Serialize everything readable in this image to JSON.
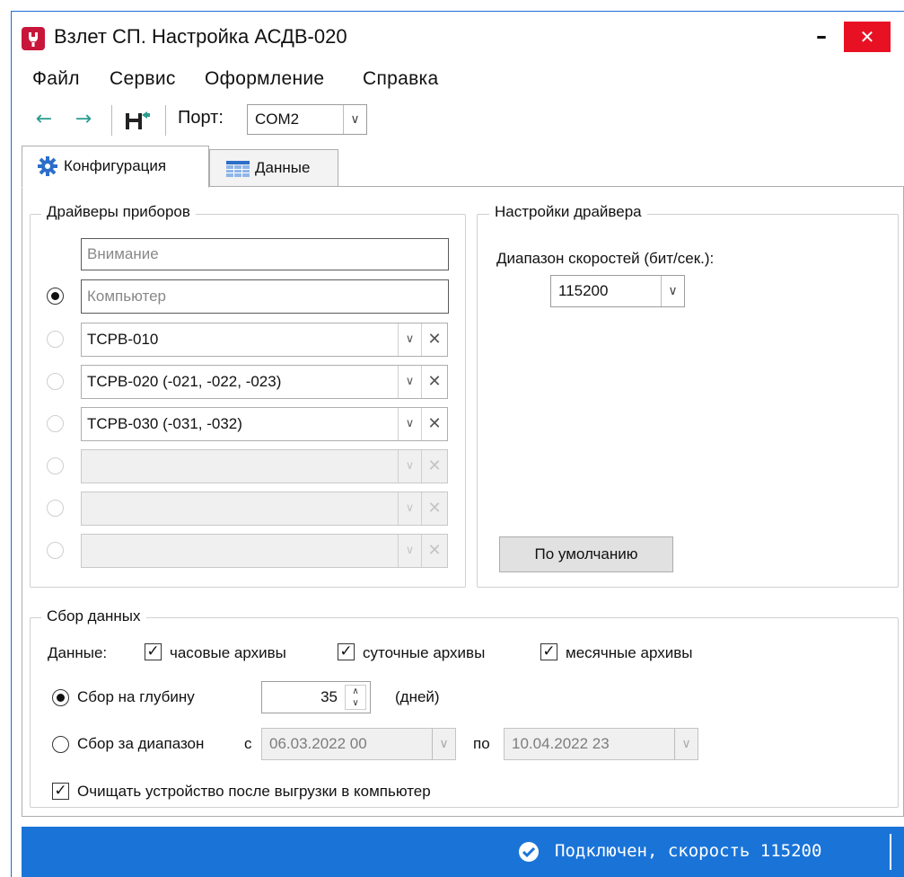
{
  "window": {
    "app_icon": "wrench-icon",
    "title": "Взлет СП. Настройка АСДВ-020",
    "minimize": "–",
    "close": "✕"
  },
  "menu": [
    "Файл",
    "Сервис",
    "Оформление",
    "Справка"
  ],
  "toolbar": {
    "back_icon": "←",
    "forward_icon": "→",
    "port_label": "Порт:",
    "port_value": "COM2"
  },
  "tabs": [
    {
      "label": "Конфигурация",
      "icon": "gear-icon",
      "active": true
    },
    {
      "label": "Данные",
      "icon": "table-icon",
      "active": false
    }
  ],
  "drivers": {
    "title": "Драйверы приборов",
    "warning_placeholder": "Внимание",
    "computer_placeholder": "Компьютер",
    "rows": [
      {
        "value": "ТСРВ-010",
        "enabled": true
      },
      {
        "value": "ТСРВ-020 (-021, -022, -023)",
        "enabled": true
      },
      {
        "value": "ТСРВ-030 (-031, -032)",
        "enabled": true
      },
      {
        "value": "",
        "enabled": false
      },
      {
        "value": "",
        "enabled": false
      },
      {
        "value": "",
        "enabled": false
      }
    ]
  },
  "driver_settings": {
    "title": "Настройки драйвера",
    "speed_label": "Диапазон скоростей (бит/сек.):",
    "speed_value": "115200",
    "default_button": "По умолчанию"
  },
  "collection": {
    "title": "Сбор данных",
    "data_label": "Данные:",
    "hourly": "часовые архивы",
    "daily": "суточные архивы",
    "monthly": "месячные архивы",
    "depth_label": "Сбор на глубину",
    "depth_value": "35",
    "days_label": "(дней)",
    "range_label": "Сбор за диапазон",
    "from_label": "с",
    "from_value": "06.03.2022 00",
    "to_label": "по",
    "to_value": "10.04.2022 23",
    "clear_label": "Очищать устройство после выгрузки в компьютер"
  },
  "status": {
    "text": "Подключен, скорость 115200",
    "icon": "check-circle-icon"
  }
}
